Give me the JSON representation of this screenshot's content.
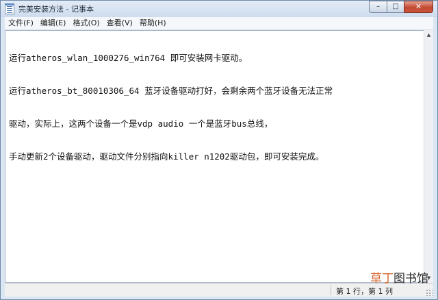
{
  "window": {
    "title": "完美安装方法 - 记事本",
    "controls": {
      "minimize": "–",
      "maximize": "□",
      "close": "✕"
    }
  },
  "menu": [
    {
      "label": "文件(F)"
    },
    {
      "label": "编辑(E)"
    },
    {
      "label": "格式(O)"
    },
    {
      "label": "查看(V)"
    },
    {
      "label": "帮助(H)"
    }
  ],
  "editor": {
    "lines": [
      "运行atheros_wlan_1000276_win764 即可安装网卡驱动。",
      "运行atheros_bt_80010306_64 蓝牙设备驱动打好，会剩余两个蓝牙设备无法正常",
      "驱动，实际上，这两个设备一个是vdp audio 一个是蓝牙bus总线，",
      "手动更新2个设备驱动，驱动文件分别指向killer n1202驱动包，即可安装完成。"
    ]
  },
  "scrollbar": {
    "up": "▲",
    "down": "▼"
  },
  "status": {
    "position": "第 1 行，第 1 列"
  },
  "watermark": {
    "part1": "草丁",
    "part2": "图书馆"
  },
  "colors": {
    "accent": "#d9652b",
    "titlebar": "#dbe6f3",
    "close": "#c44a32"
  }
}
